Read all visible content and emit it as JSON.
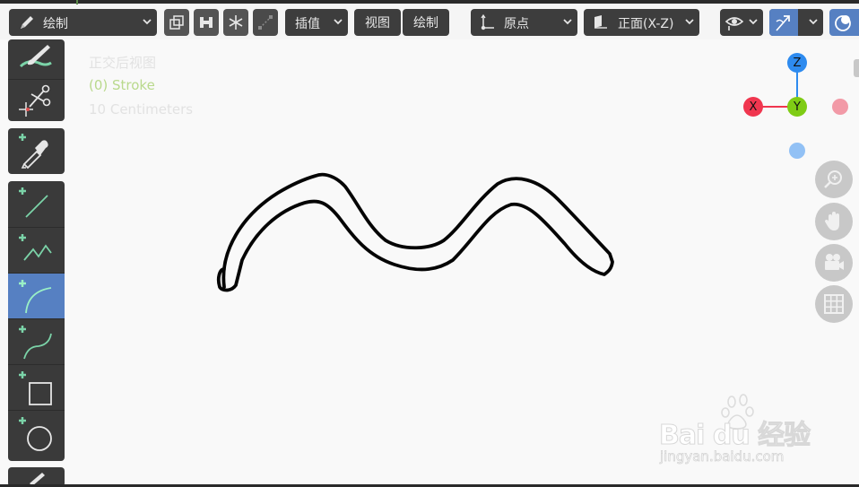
{
  "header": {
    "mode_label": "绘制",
    "interp_label": "插值",
    "view_label": "视图",
    "draw_label": "绘制",
    "origin_label": "原点",
    "plane_label": "正面(X-Z)"
  },
  "overlay": {
    "view_name": "正交后视图",
    "layer": "(0) Stroke",
    "scale": "10 Centimeters"
  },
  "gizmo": {
    "x_label": "X",
    "y_label": "Y",
    "z_label": "Z",
    "x_color": "#f0364f",
    "y_color": "#7fcc15",
    "z_color": "#2e8bef"
  },
  "toolbar": {
    "tools": [
      "draw-tool",
      "cutter-tool",
      "eyedropper-tool",
      "line-tool",
      "polyline-tool",
      "arc-tool",
      "curve-tool",
      "box-tool",
      "circle-tool"
    ],
    "active_tool": "arc-tool"
  },
  "watermark": {
    "brand": "Bai du 经验",
    "url": "jingyan.baidu.com"
  },
  "colors": {
    "accent": "#5680c2",
    "header_button": "#3d3d3d",
    "viewport_bg": "#f9f9f9"
  }
}
